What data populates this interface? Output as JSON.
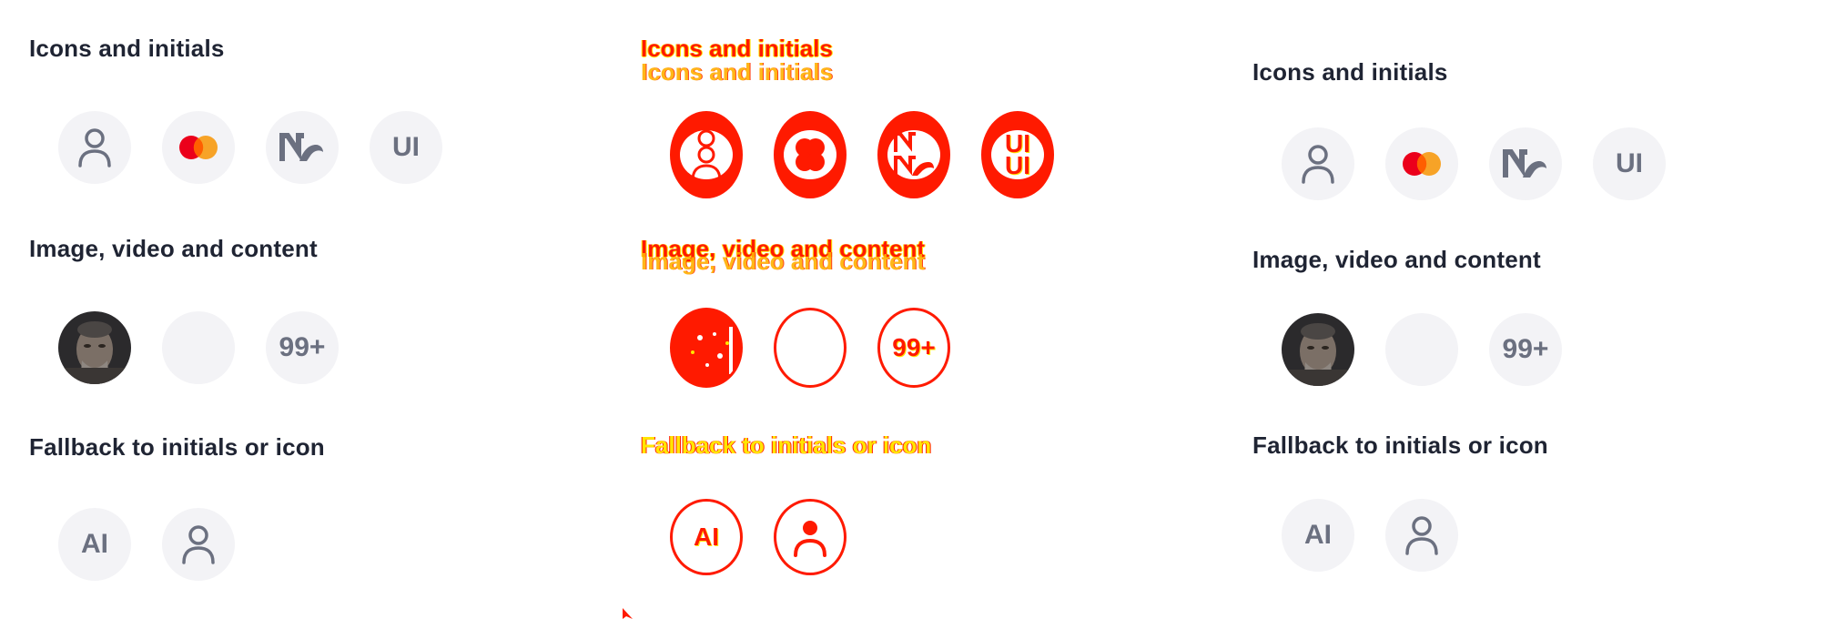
{
  "sections": {
    "icons": {
      "title": "Icons and initials",
      "initials": "UI"
    },
    "media": {
      "title": "Image, video and content",
      "count": "99+"
    },
    "fallback": {
      "title": "Fallback to initials or icon",
      "initials": "AI"
    }
  },
  "colors": {
    "avatar_bg": "#f3f3f6",
    "avatar_fg": "#6b7080",
    "heading": "#1f2433",
    "diff_red": "#ff1a00",
    "diff_yellow": "#ffe600",
    "mastercard_red": "#eb001b",
    "mastercard_orange": "#f79e1b"
  },
  "icons": [
    "person-icon",
    "mastercard-icon",
    "nx-logo-icon"
  ]
}
